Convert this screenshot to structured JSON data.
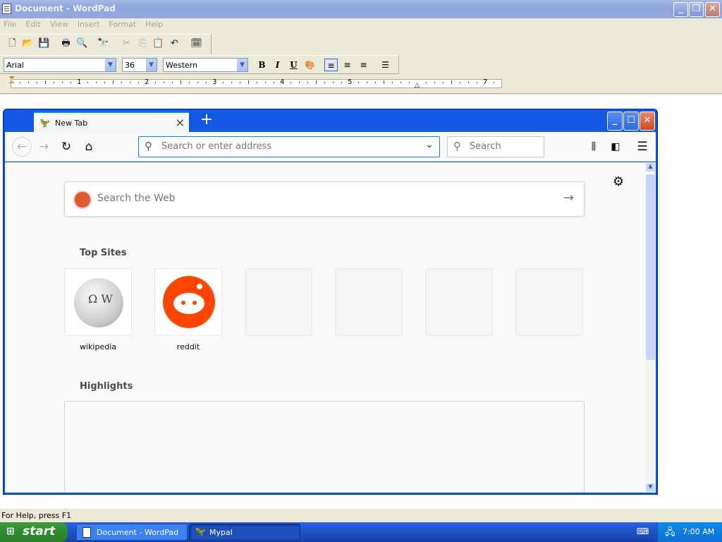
{
  "wordpad": {
    "title": "Document - WordPad",
    "menu": [
      "File",
      "Edit",
      "View",
      "Insert",
      "Format",
      "Help"
    ],
    "font_name": "Arial",
    "font_size": "36",
    "script": "Western",
    "ruler_numbers": [
      "1",
      "2",
      "3",
      "4",
      "5",
      "7"
    ],
    "status": "For Help, press F1"
  },
  "browser": {
    "tab_title": "New Tab",
    "url_placeholder": "Search or enter address",
    "search_placeholder": "Search",
    "web_search_placeholder": "Search the Web",
    "top_sites_heading": "Top Sites",
    "highlights_heading": "Highlights",
    "top_sites": [
      {
        "label": "wikipedia"
      },
      {
        "label": "reddit"
      },
      {
        "label": ""
      },
      {
        "label": ""
      },
      {
        "label": ""
      },
      {
        "label": ""
      }
    ]
  },
  "taskbar": {
    "start_label": "start",
    "tasks": [
      {
        "label": "Document - WordPad",
        "active": false
      },
      {
        "label": "Mypal",
        "active": true
      }
    ],
    "clock": "7:00 AM"
  },
  "colors": {
    "xp_blue": "#245edb",
    "start_green": "#2f8a2f",
    "reddit_orange": "#ff4500",
    "focus_blue": "#0a84ff"
  }
}
